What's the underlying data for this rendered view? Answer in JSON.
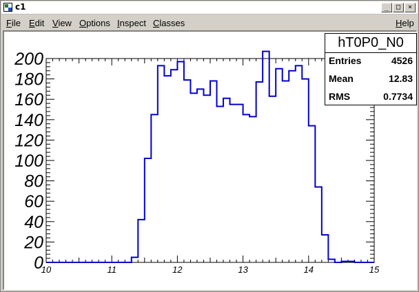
{
  "window": {
    "title": "c1",
    "buttons": {
      "minimize": "_",
      "maximize": "□",
      "close": "×"
    }
  },
  "menu": {
    "items": [
      "File",
      "Edit",
      "View",
      "Options",
      "Inspect",
      "Classes"
    ],
    "help": "Help"
  },
  "stats": {
    "name": "hT0P0_N0",
    "entries_label": "Entries",
    "entries_value": "4526",
    "mean_label": "Mean",
    "mean_value": "12.83",
    "rms_label": "RMS",
    "rms_value": "0.7734"
  },
  "chart_data": {
    "type": "histogram",
    "title": "",
    "xlabel": "",
    "ylabel": "",
    "xlim": [
      10,
      15
    ],
    "ylim": [
      0,
      200
    ],
    "bin_width": 0.1,
    "bin_edges_start": 10,
    "values": [
      0,
      0,
      0,
      0,
      0,
      0,
      0,
      0,
      0,
      0,
      0,
      0,
      0,
      5,
      42,
      102,
      145,
      193,
      183,
      189,
      197,
      179,
      166,
      170,
      164,
      178,
      153,
      161,
      155,
      155,
      145,
      143,
      177,
      207,
      163,
      190,
      178,
      188,
      193,
      180,
      134,
      74,
      27,
      3,
      0,
      1,
      1,
      0,
      0,
      0
    ],
    "x_ticks": [
      10,
      11,
      12,
      13,
      14,
      15
    ],
    "y_ticks": [
      0,
      20,
      40,
      60,
      80,
      100,
      120,
      140,
      160,
      180,
      200
    ],
    "line_color": "#0000cc"
  }
}
